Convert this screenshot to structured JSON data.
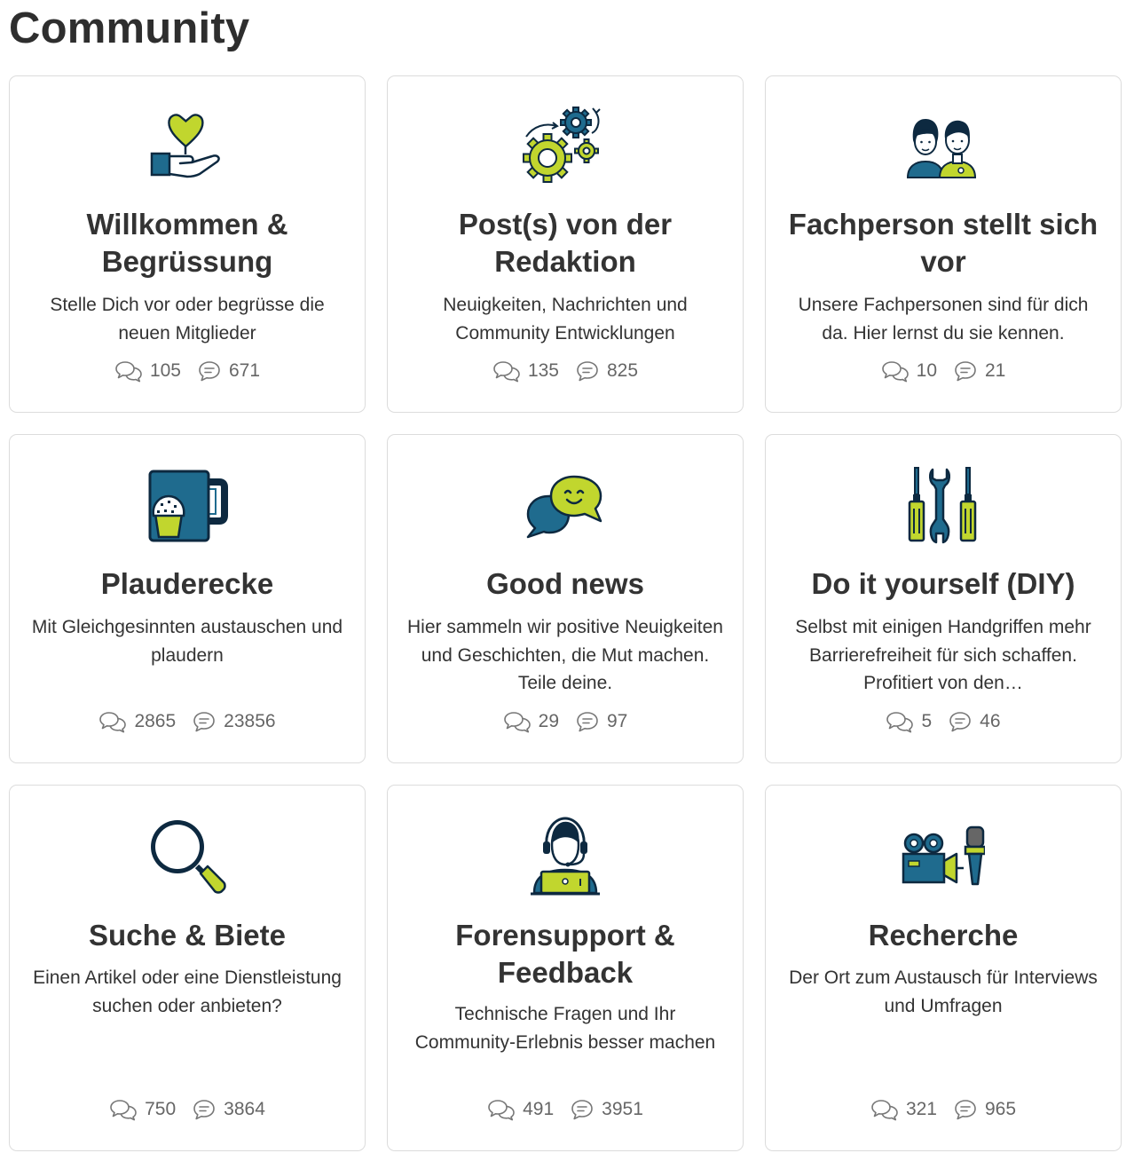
{
  "page": {
    "title": "Community"
  },
  "colors": {
    "navy": "#0d2940",
    "blue": "#1f6b8e",
    "lime": "#c1d62e",
    "text": "#333333",
    "muted": "#666666",
    "border": "#dcdcdc"
  },
  "cards": [
    {
      "title": "Willkommen & Begrüssung",
      "description": "Stelle Dich vor oder begrüsse die neuen Mitglieder",
      "topics": "105",
      "posts": "671",
      "icon": "heart-hand-icon"
    },
    {
      "title": "Post(s) von der Redaktion",
      "description": "Neuigkeiten, Nachrichten und Community Entwicklungen",
      "topics": "135",
      "posts": "825",
      "icon": "gears-icon"
    },
    {
      "title": "Fachperson stellt sich vor",
      "description": "Unsere Fachpersonen sind für dich da. Hier lernst du sie kennen.",
      "topics": "10",
      "posts": "21",
      "icon": "people-icon"
    },
    {
      "title": "Plauderecke",
      "description": "Mit Gleichgesinnten austauschen und plaudern",
      "topics": "2865",
      "posts": "23856",
      "icon": "mug-icon"
    },
    {
      "title": "Good news",
      "description": "Hier sammeln wir positive Neuigkeiten und Geschichten, die Mut machen. Teile deine.",
      "topics": "29",
      "posts": "97",
      "icon": "smile-chat-icon"
    },
    {
      "title": "Do it yourself (DIY)",
      "description": "Selbst mit einigen Handgriffen mehr Barrierefreiheit für sich schaffen. Profitiert von den…",
      "topics": "5",
      "posts": "46",
      "icon": "tools-icon"
    },
    {
      "title": "Suche & Biete",
      "description": "Einen Artikel oder eine Dienstleistung suchen oder anbieten?",
      "topics": "750",
      "posts": "3864",
      "icon": "magnifier-icon"
    },
    {
      "title": "Forensupport & Feedback",
      "description": "Technische Fragen und Ihr Community-Erlebnis besser machen",
      "topics": "491",
      "posts": "3951",
      "icon": "support-agent-icon"
    },
    {
      "title": "Recherche",
      "description": "Der Ort zum Austausch für Interviews und Umfragen",
      "topics": "321",
      "posts": "965",
      "icon": "camera-microphone-icon"
    }
  ]
}
